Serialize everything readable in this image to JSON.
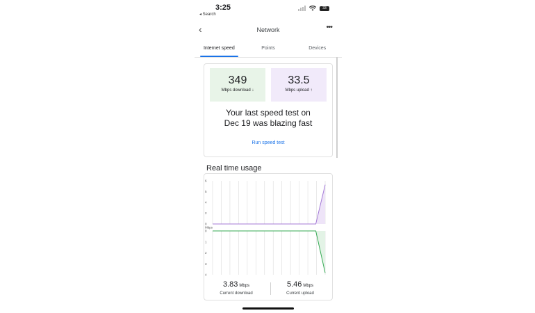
{
  "status_bar": {
    "time": "3:25",
    "back_label": "◂ Search",
    "battery": "33"
  },
  "app_bar": {
    "title": "Network"
  },
  "tabs": [
    {
      "label": "Internet speed",
      "active": true
    },
    {
      "label": "Points",
      "active": false
    },
    {
      "label": "Devices",
      "active": false
    }
  ],
  "speed": {
    "download": {
      "value": "349",
      "label": "Mbps download ↓"
    },
    "upload": {
      "value": "33.5",
      "label": "Mbps upload ↑"
    },
    "message": "Your last speed test on Dec 19 was blazing fast",
    "run_test_label": "Run speed test"
  },
  "realtime": {
    "title": "Real time usage",
    "current_download": {
      "value": "3.83",
      "unit": "Mbps",
      "label": "Current download"
    },
    "current_upload": {
      "value": "5.46",
      "unit": "Mbps",
      "label": "Current upload"
    }
  },
  "chart_data": {
    "type": "area",
    "unit_label": "Mbps",
    "upper_ticks": [
      "6",
      "5",
      "4",
      "2",
      "0"
    ],
    "lower_ticks": [
      "0",
      "1",
      "2",
      "3",
      "4"
    ],
    "upload_series": {
      "name": "upload",
      "color": "#a47bd6",
      "values": [
        0,
        0,
        0,
        0,
        0,
        0,
        0,
        0,
        0,
        0,
        0,
        0,
        5.46
      ]
    },
    "download_series": {
      "name": "download",
      "color": "#34a853",
      "values": [
        0,
        0,
        0,
        0,
        0,
        0,
        0,
        0,
        0,
        0,
        0,
        0,
        3.83
      ]
    }
  },
  "colors": {
    "accent": "#1a73e8",
    "download_bg": "#e8f4e8",
    "upload_bg": "#f1eafa"
  }
}
